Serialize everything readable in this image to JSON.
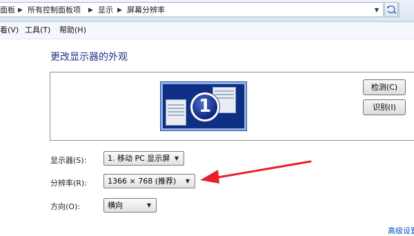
{
  "address_bar": {
    "crumbs": [
      "面板",
      "所有控制面板项",
      "显示",
      "屏幕分辨率"
    ],
    "dropdown_icon": "chevron-down-icon",
    "refresh_icon": "refresh-icon"
  },
  "menu": {
    "items": [
      "看(V)",
      "工具(T)",
      "帮助(H)"
    ]
  },
  "main": {
    "heading": "更改显示器的外观",
    "monitor_badge": "1",
    "detect_button": "检测(C)",
    "identify_button": "识别(I)",
    "display_label": "显示器(S):",
    "display_value": "1. 移动 PC 显示屏",
    "resolution_label": "分辨率(R):",
    "resolution_value": "1366 × 768 (推荐)",
    "orientation_label": "方向(O):",
    "orientation_value": "横向",
    "advanced_link": "高级设置"
  },
  "colors": {
    "heading": "#1e3287",
    "annotation_arrow": "#e8202a",
    "link": "#0b53c4"
  }
}
